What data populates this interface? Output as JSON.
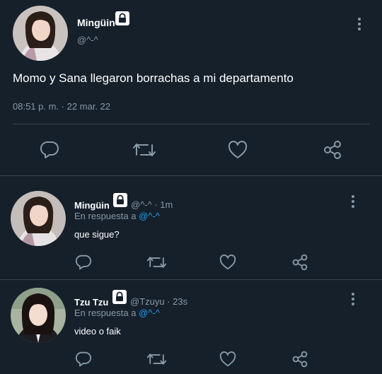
{
  "main_tweet": {
    "display_name": "Mingüin",
    "handle": "@^-^",
    "text": "Momo y Sana llegaron borrachas a mi departamento",
    "time": "08:51 p. m. · 22 mar. 22"
  },
  "replies": [
    {
      "display_name": "Mingüin",
      "handle_time": "@^-^ · 1m",
      "reply_prefix": "En respuesta a",
      "reply_to": "@^-^",
      "text": "que sigue?"
    },
    {
      "display_name": "Tzu Tzu",
      "handle_time": "@Tzuyu · 23s",
      "reply_prefix": "En respuesta a",
      "reply_to": "@^-^",
      "text": "video o faik"
    }
  ],
  "icons": [
    "lock-icon",
    "more-icon",
    "reply-icon",
    "retweet-icon",
    "like-icon",
    "share-icon"
  ],
  "colors": {
    "background": "#15202b",
    "divider": "#38444d",
    "muted": "#8899a6",
    "link": "#1da1f2"
  }
}
